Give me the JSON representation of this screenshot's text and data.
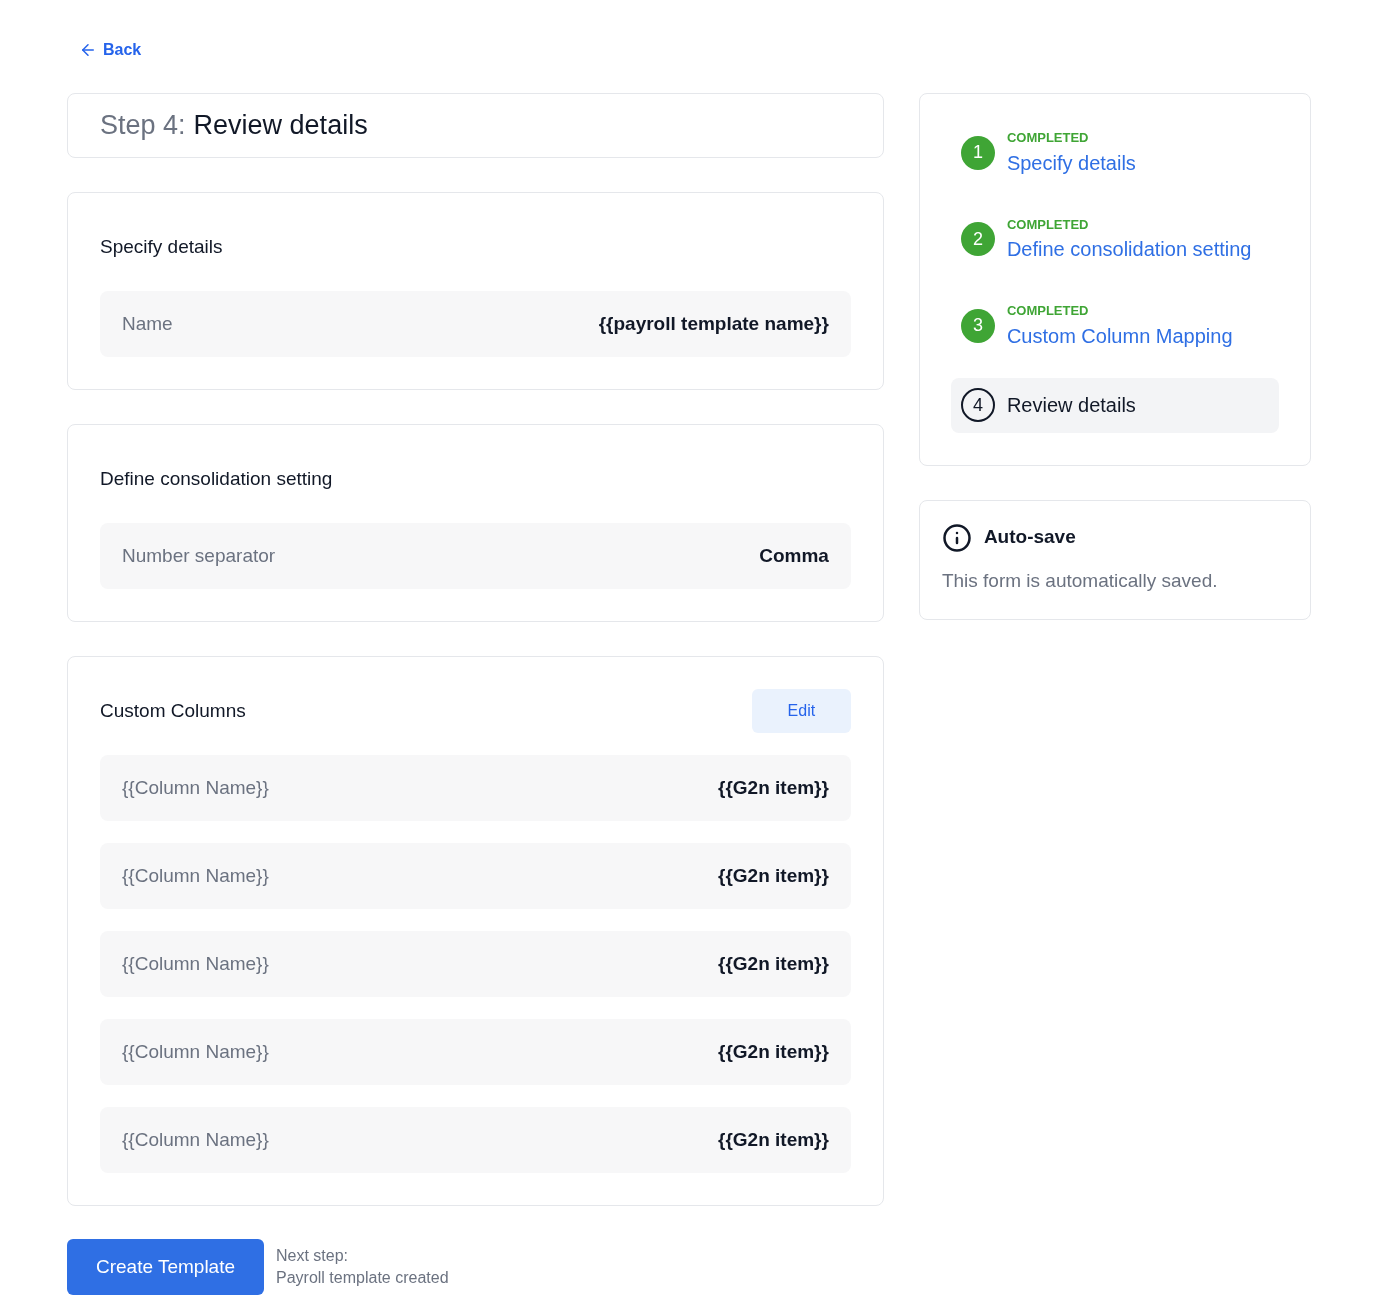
{
  "back": {
    "label": "Back"
  },
  "header": {
    "step": "Step 4:",
    "title": "Review details"
  },
  "sections": [
    {
      "title": "Specify details",
      "rows": [
        {
          "label": "Name",
          "value": "{{payroll template name}}"
        }
      ]
    },
    {
      "title": "Define consolidation setting",
      "rows": [
        {
          "label": "Number separator",
          "value": "Comma"
        }
      ]
    },
    {
      "title": "Custom Columns",
      "action": "Edit",
      "rows": [
        {
          "label": "{{Column Name}}",
          "value": "{{G2n item}}"
        },
        {
          "label": "{{Column Name}}",
          "value": "{{G2n item}}"
        },
        {
          "label": "{{Column Name}}",
          "value": "{{G2n item}}"
        },
        {
          "label": "{{Column Name}}",
          "value": "{{G2n item}}"
        },
        {
          "label": "{{Column Name}}",
          "value": "{{G2n item}}"
        }
      ]
    }
  ],
  "steps": [
    {
      "number": "1",
      "status": "COMPLETED",
      "title": "Specify details",
      "completed": true,
      "selected": false
    },
    {
      "number": "2",
      "status": "COMPLETED",
      "title": "Define consolidation setting",
      "completed": true,
      "selected": false
    },
    {
      "number": "3",
      "status": "COMPLETED",
      "title": "Custom Column Mapping",
      "completed": true,
      "selected": false
    },
    {
      "number": "4",
      "title": "Review details",
      "completed": false,
      "selected": true
    }
  ],
  "autosave": {
    "title": "Auto-save",
    "text": "This form is automatically saved."
  },
  "footer": {
    "button": "Create Template",
    "next_label": "Next step:",
    "next_value": "Payroll template created"
  }
}
